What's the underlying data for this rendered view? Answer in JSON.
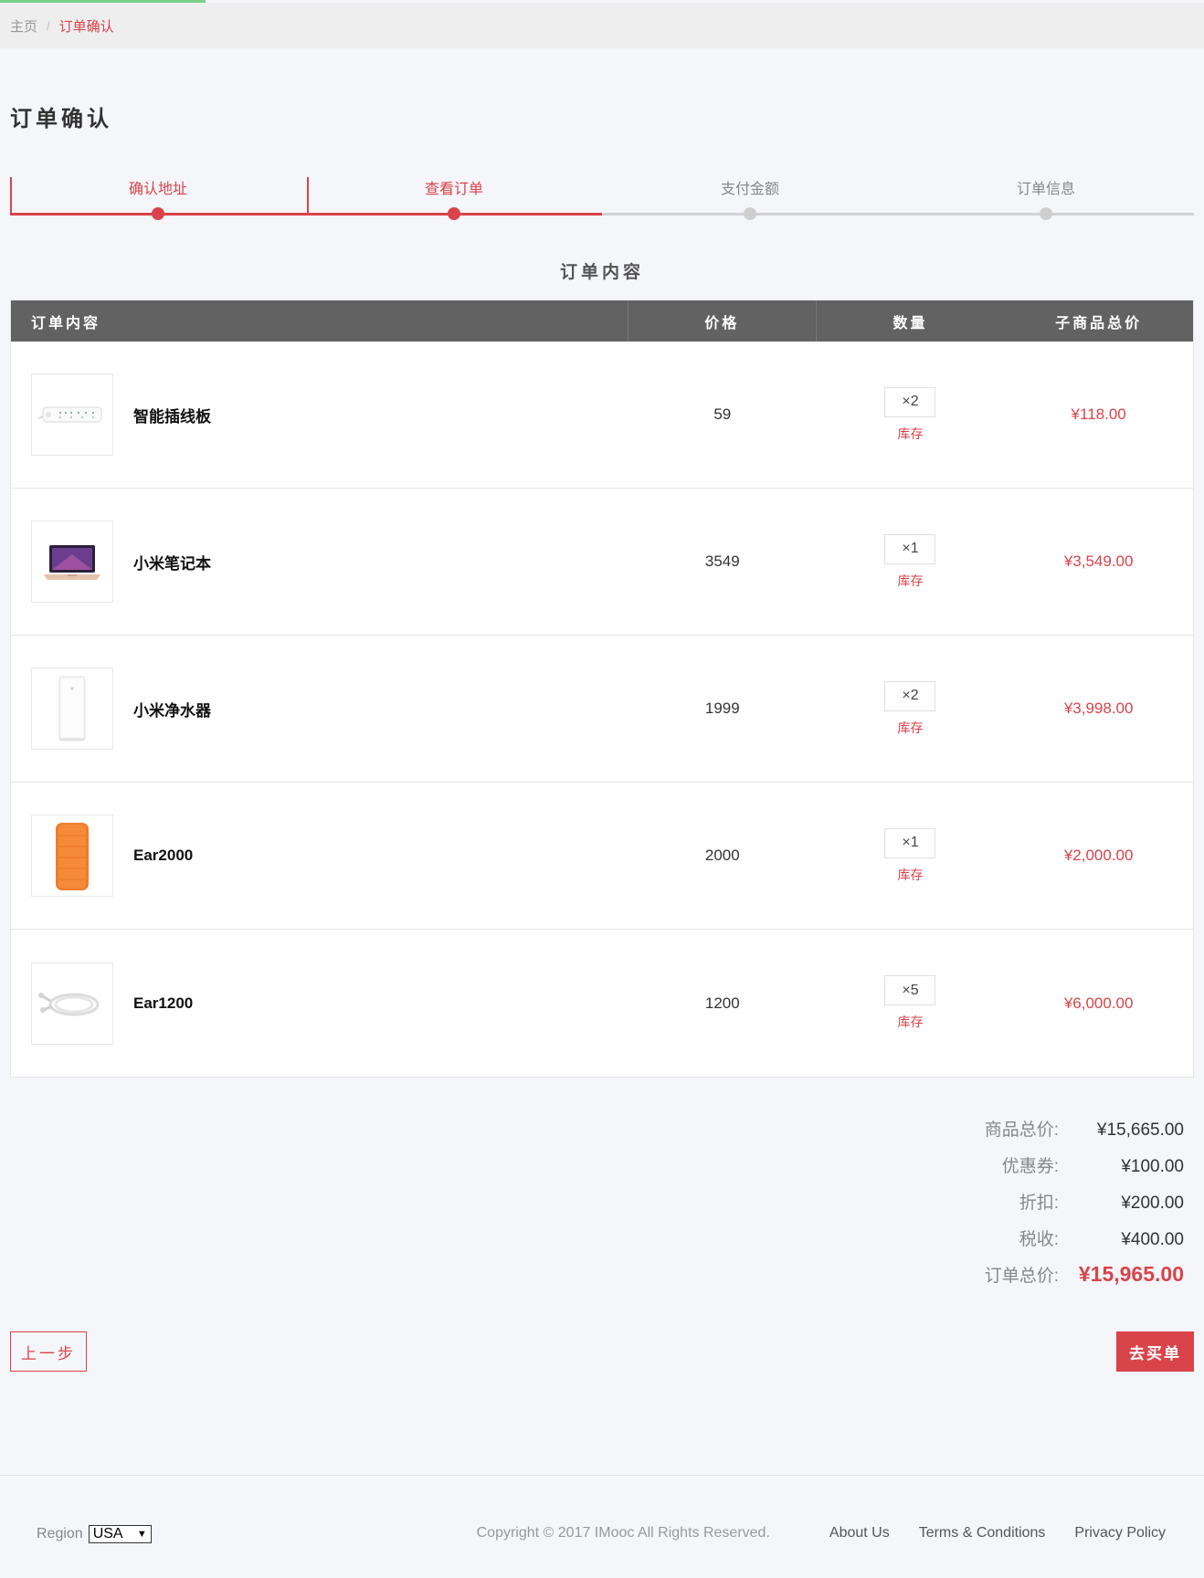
{
  "breadcrumb": {
    "home": "主页",
    "separator": "/",
    "current": "订单确认"
  },
  "page_title": "订单确认",
  "steps": [
    {
      "label": "确认地址",
      "state": "done"
    },
    {
      "label": "查看订单",
      "state": "active"
    },
    {
      "label": "支付金额",
      "state": "pending"
    },
    {
      "label": "订单信息",
      "state": "pending"
    }
  ],
  "section_title": "订单内容",
  "table": {
    "headers": {
      "name": "订单内容",
      "price": "价格",
      "qty": "数量",
      "subtotal": "子商品总价"
    },
    "rows": [
      {
        "name": "智能插线板",
        "price": "59",
        "qty": "×2",
        "stock": "库存",
        "subtotal": "¥118.00",
        "icon": "power-strip-icon"
      },
      {
        "name": "小米笔记本",
        "price": "3549",
        "qty": "×1",
        "stock": "库存",
        "subtotal": "¥3,549.00",
        "icon": "laptop-icon"
      },
      {
        "name": "小米净水器",
        "price": "1999",
        "qty": "×2",
        "stock": "库存",
        "subtotal": "¥3,998.00",
        "icon": "water-purifier-icon"
      },
      {
        "name": "Ear2000",
        "price": "2000",
        "qty": "×1",
        "stock": "库存",
        "subtotal": "¥2,000.00",
        "icon": "speaker-icon"
      },
      {
        "name": "Ear1200",
        "price": "1200",
        "qty": "×5",
        "stock": "库存",
        "subtotal": "¥6,000.00",
        "icon": "earphone-icon"
      }
    ]
  },
  "summary": {
    "goods_total_label": "商品总价:",
    "goods_total": "¥15,665.00",
    "coupon_label": "优惠券:",
    "coupon": "¥100.00",
    "discount_label": "折扣:",
    "discount": "¥200.00",
    "tax_label": "税收:",
    "tax": "¥400.00",
    "order_total_label": "订单总价:",
    "order_total": "¥15,965.00"
  },
  "buttons": {
    "prev": "上一步",
    "buy": "去买单"
  },
  "footer": {
    "region_label": "Region",
    "region_value": "USA",
    "copyright": "Copyright © 2017 IMooc All Rights Reserved.",
    "links": [
      "About Us",
      "Terms & Conditions",
      "Privacy Policy"
    ]
  },
  "colors": {
    "accent": "#d9434a",
    "header_bg": "#626262",
    "page_bg": "#f5f6fa"
  }
}
